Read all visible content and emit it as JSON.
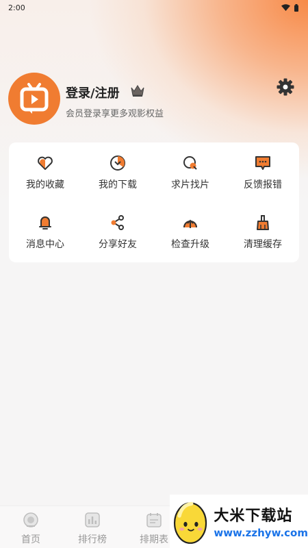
{
  "status_bar": {
    "time": "2:00"
  },
  "profile": {
    "title": "登录/注册",
    "subtitle": "会员登录享更多观影权益"
  },
  "colors": {
    "accent": "#f07c31",
    "text": "#333333",
    "muted": "#999999"
  },
  "menu": {
    "items": [
      {
        "label": "我的收藏",
        "icon": "heart-icon"
      },
      {
        "label": "我的下载",
        "icon": "download-icon"
      },
      {
        "label": "求片找片",
        "icon": "search-film-icon"
      },
      {
        "label": "反馈报错",
        "icon": "feedback-icon"
      },
      {
        "label": "消息中心",
        "icon": "bell-icon"
      },
      {
        "label": "分享好友",
        "icon": "share-icon"
      },
      {
        "label": "检查升级",
        "icon": "upgrade-icon"
      },
      {
        "label": "清理缓存",
        "icon": "broom-icon"
      }
    ]
  },
  "bottom_nav": {
    "items": [
      {
        "label": "首页",
        "icon": "home-icon"
      },
      {
        "label": "排行榜",
        "icon": "ranking-icon"
      },
      {
        "label": "排期表",
        "icon": "calendar-icon"
      }
    ]
  },
  "watermark": {
    "title": "大米下载站",
    "url": "www.zzhyw.com"
  }
}
